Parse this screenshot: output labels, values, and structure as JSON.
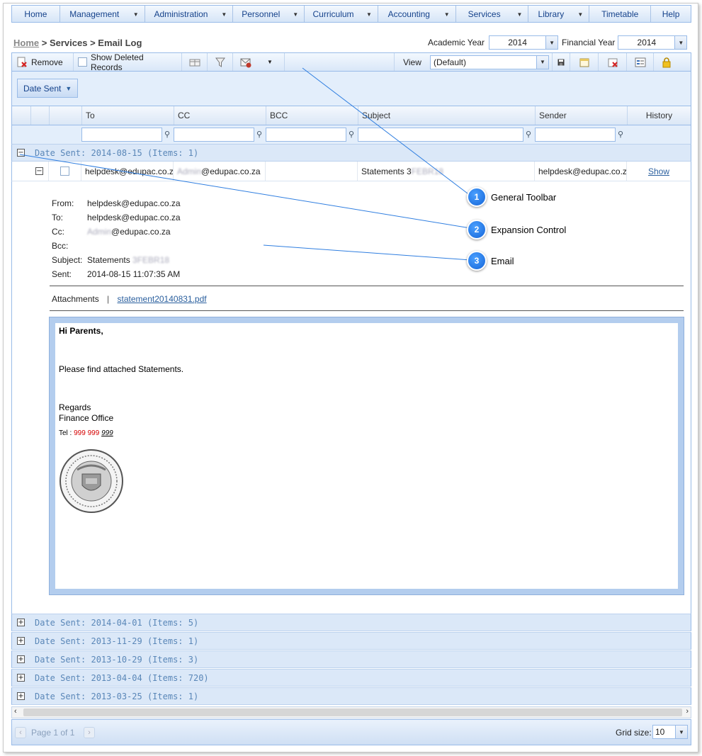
{
  "nav": {
    "items": [
      {
        "label": "Home",
        "dropdown": false
      },
      {
        "label": "Management",
        "dropdown": true
      },
      {
        "label": "Administration",
        "dropdown": true
      },
      {
        "label": "Personnel",
        "dropdown": true
      },
      {
        "label": "Curriculum",
        "dropdown": true
      },
      {
        "label": "Accounting",
        "dropdown": true
      },
      {
        "label": "Services",
        "dropdown": true
      },
      {
        "label": "Library",
        "dropdown": true
      },
      {
        "label": "Timetable",
        "dropdown": false
      },
      {
        "label": "Help",
        "dropdown": false
      }
    ]
  },
  "breadcrumb": {
    "home": "Home",
    "sep1": " > ",
    "section": "Services",
    "sep2": " > ",
    "page": "Email Log"
  },
  "years": {
    "academic_label": "Academic Year",
    "academic_value": "2014",
    "financial_label": "Financial Year",
    "financial_value": "2014"
  },
  "toolbar": {
    "remove_label": "Remove",
    "show_deleted_label": "Show Deleted Records",
    "view_label": "View",
    "view_value": "(Default)"
  },
  "groupby": {
    "chip_label": "Date Sent"
  },
  "grid": {
    "columns": {
      "to": "To",
      "cc": "CC",
      "bcc": "BCC",
      "subject": "Subject",
      "sender": "Sender",
      "history": "History"
    }
  },
  "groups": [
    {
      "label": "Date Sent: 2014-08-15 (Items: 1)",
      "expanded": true
    },
    {
      "label": "Date Sent: 2014-04-01 (Items: 5)",
      "expanded": false
    },
    {
      "label": "Date Sent: 2013-11-29 (Items: 1)",
      "expanded": false
    },
    {
      "label": "Date Sent: 2013-10-29 (Items: 3)",
      "expanded": false
    },
    {
      "label": "Date Sent: 2013-04-04 (Items: 720)",
      "expanded": false
    },
    {
      "label": "Date Sent: 2013-03-25 (Items: 1)",
      "expanded": false
    }
  ],
  "row": {
    "to": "helpdesk@edupac.co.za",
    "cc_blur": "Admin",
    "cc_domain": "@edupac.co.za",
    "subject_prefix": "Statements 3",
    "subject_blur": "FEBR18",
    "sender": "helpdesk@edupac.co.za",
    "history_link": "Show"
  },
  "email": {
    "from_label": "From:",
    "from_value": "helpdesk@edupac.co.za",
    "to_label": "To:",
    "to_value": "helpdesk@edupac.co.za",
    "cc_label": "Cc:",
    "cc_blur": "Admin",
    "cc_domain": "@edupac.co.za",
    "bcc_label": "Bcc:",
    "subject_label": "Subject:",
    "subject_prefix": "Statements ",
    "subject_blur": "3FEBR18",
    "sent_label": "Sent:",
    "sent_value": "2014-08-15 11:07:35 AM",
    "attachments_label": "Attachments",
    "attachments_sep": "|",
    "attachment_file": "statement20140831.pdf",
    "greeting": "Hi Parents,",
    "body": "Please find attached Statements.",
    "regards": "Regards",
    "signoff": "Finance Office",
    "tel_label": "Tel : ",
    "tel_red": "999 999 ",
    "tel_link": "999"
  },
  "callouts": [
    {
      "number": "1",
      "label": "General Toolbar"
    },
    {
      "number": "2",
      "label": "Expansion Control"
    },
    {
      "number": "3",
      "label": "Email"
    }
  ],
  "pager": {
    "page_text": "Page 1 of 1",
    "grid_size_label": "Grid size:",
    "grid_size_value": "10"
  },
  "colors": {
    "accent": "#99bbe8",
    "callout": "#1a6fe0",
    "tel_red": "#d40000"
  }
}
